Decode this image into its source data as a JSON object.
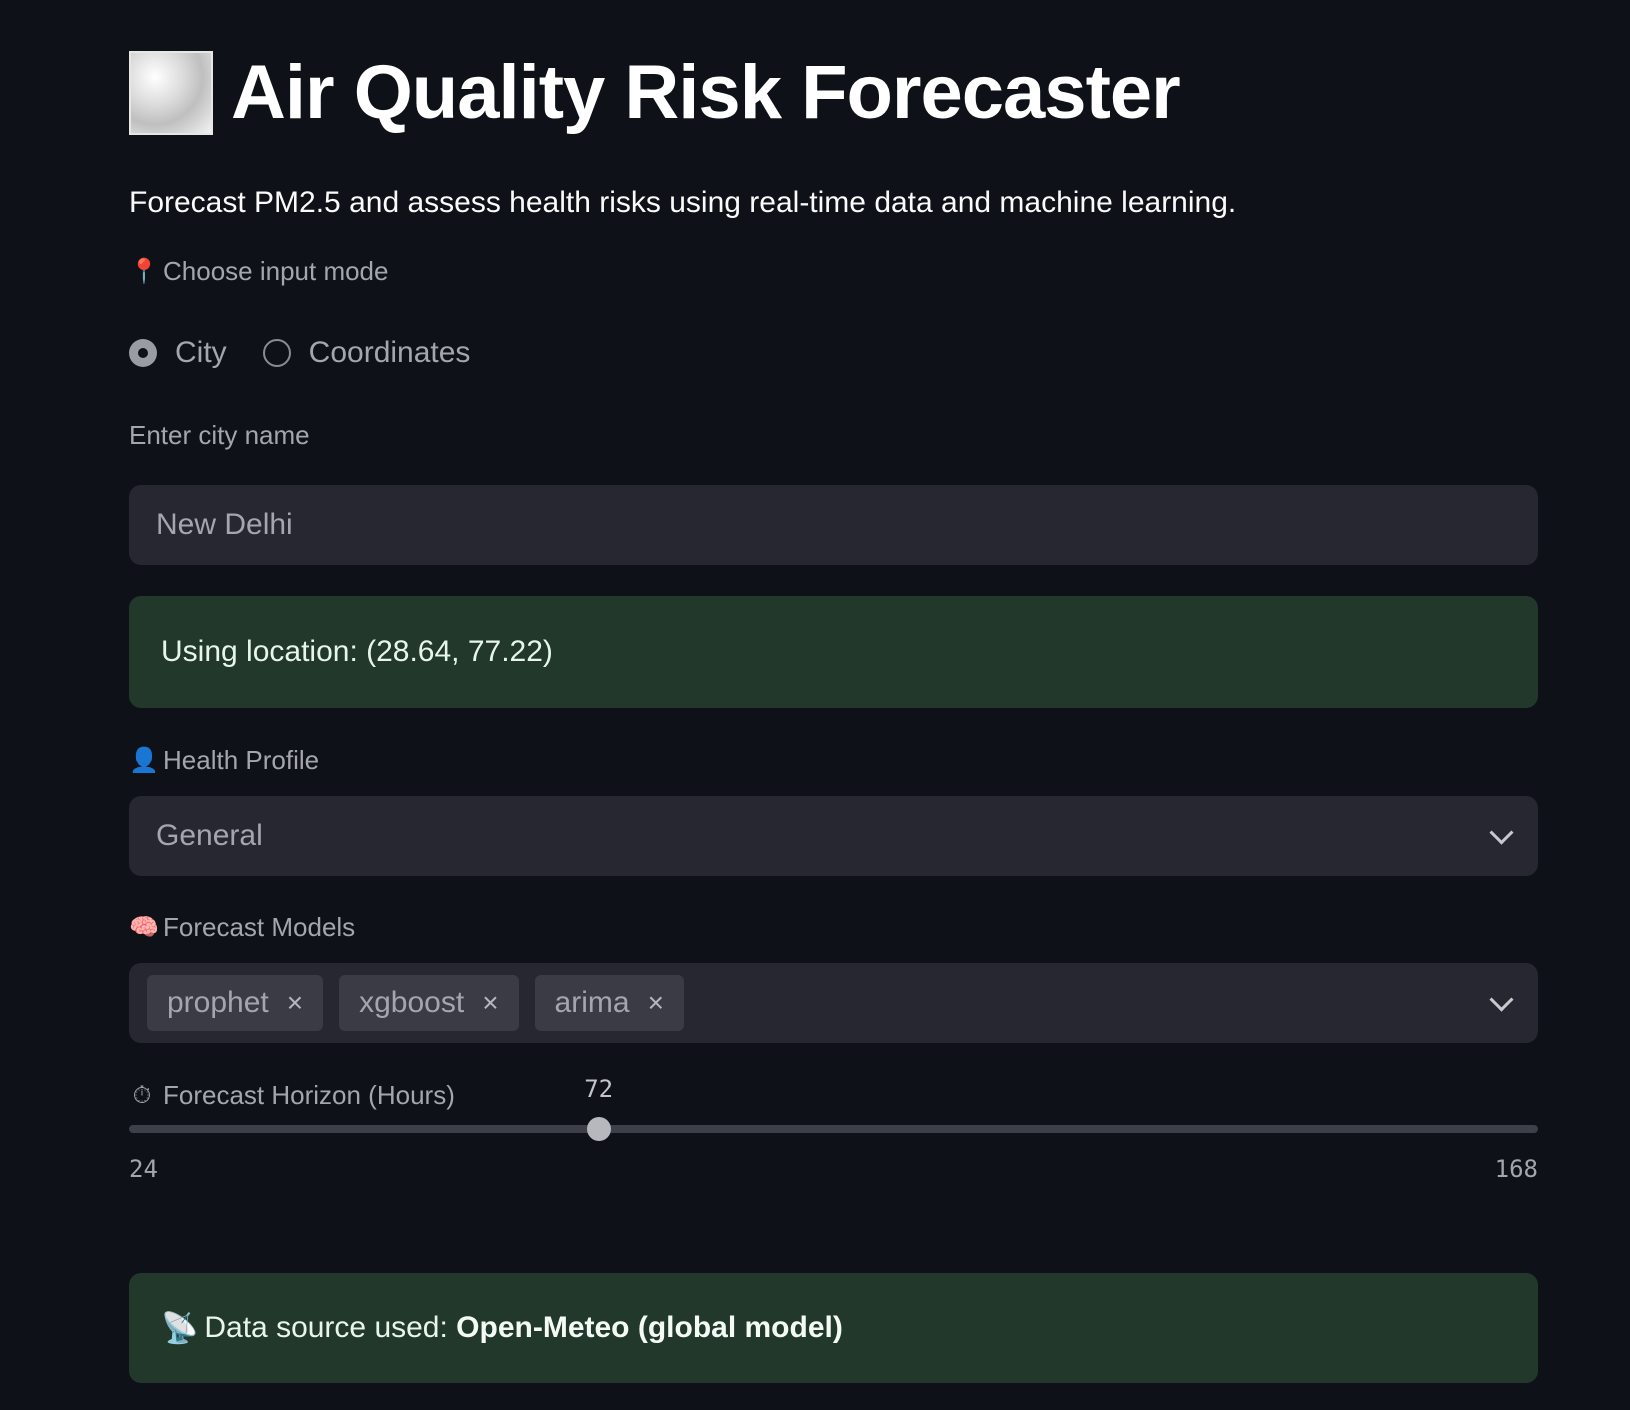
{
  "app": {
    "title": "Air Quality Risk Forecaster",
    "title_icon": "fog-emoji-icon",
    "subtitle": "Forecast PM2.5 and assess health risks using real-time data and machine learning."
  },
  "input_mode": {
    "label": "Choose input mode",
    "label_icon": "📍",
    "options": [
      "City",
      "Coordinates"
    ],
    "selected": "City"
  },
  "city": {
    "label": "Enter city name",
    "value": "New Delhi"
  },
  "location_alert": {
    "text": "Using location: (28.64, 77.22)"
  },
  "health_profile": {
    "label": "Health Profile",
    "label_icon": "👤",
    "selected": "General"
  },
  "models": {
    "label": "Forecast Models",
    "label_icon": "🧠",
    "selected": [
      "prophet",
      "xgboost",
      "arima"
    ],
    "remove_glyph": "×"
  },
  "horizon": {
    "label": "Forecast Horizon (Hours)",
    "label_icon": "⏱",
    "value": 72,
    "min": 24,
    "max": 168
  },
  "source_alert": {
    "icon": "📡",
    "prefix": "Data source used: ",
    "source": "Open-Meteo (global model)"
  },
  "colors": {
    "background": "#0e1117",
    "input_bg": "#262730",
    "success_bg": "#21382b"
  }
}
